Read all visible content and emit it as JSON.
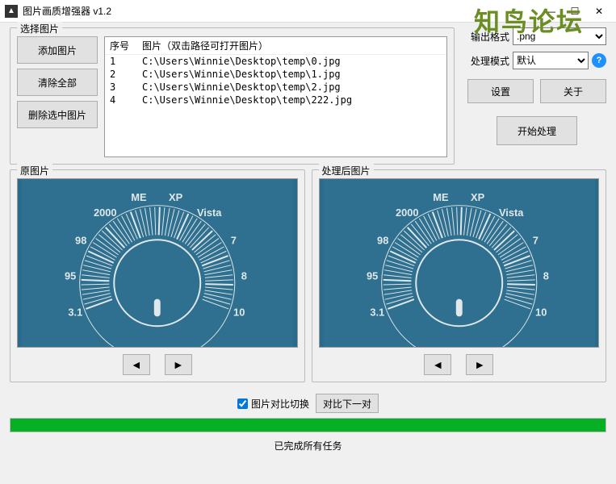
{
  "window": {
    "title": "图片画质增强器 v1.2"
  },
  "watermark": "知鸟论坛",
  "select_group": {
    "legend": "选择图片",
    "add": "添加图片",
    "clear": "清除全部",
    "delete": "删除选中图片",
    "columns": {
      "index": "序号",
      "path": "图片（双击路径可打开图片）"
    },
    "files": [
      {
        "i": "1",
        "p": "C:\\Users\\Winnie\\Desktop\\temp\\0.jpg"
      },
      {
        "i": "2",
        "p": "C:\\Users\\Winnie\\Desktop\\temp\\1.jpg"
      },
      {
        "i": "3",
        "p": "C:\\Users\\Winnie\\Desktop\\temp\\2.jpg"
      },
      {
        "i": "4",
        "p": "C:\\Users\\Winnie\\Desktop\\temp\\222.jpg"
      }
    ]
  },
  "settings": {
    "format_label": "输出格式",
    "format_value": ".png",
    "mode_label": "处理模式",
    "mode_value": "默认",
    "settings_btn": "设置",
    "about_btn": "关于",
    "start_btn": "开始处理"
  },
  "preview": {
    "original_legend": "原图片",
    "processed_legend": "处理后图片",
    "dial_labels": [
      "3.1",
      "95",
      "98",
      "2000",
      "ME",
      "XP",
      "Vista",
      "7",
      "8",
      "10"
    ]
  },
  "compare": {
    "checkbox_label": "图片对比切换",
    "checked": true,
    "next_btn": "对比下一对"
  },
  "status": "已完成所有任务"
}
